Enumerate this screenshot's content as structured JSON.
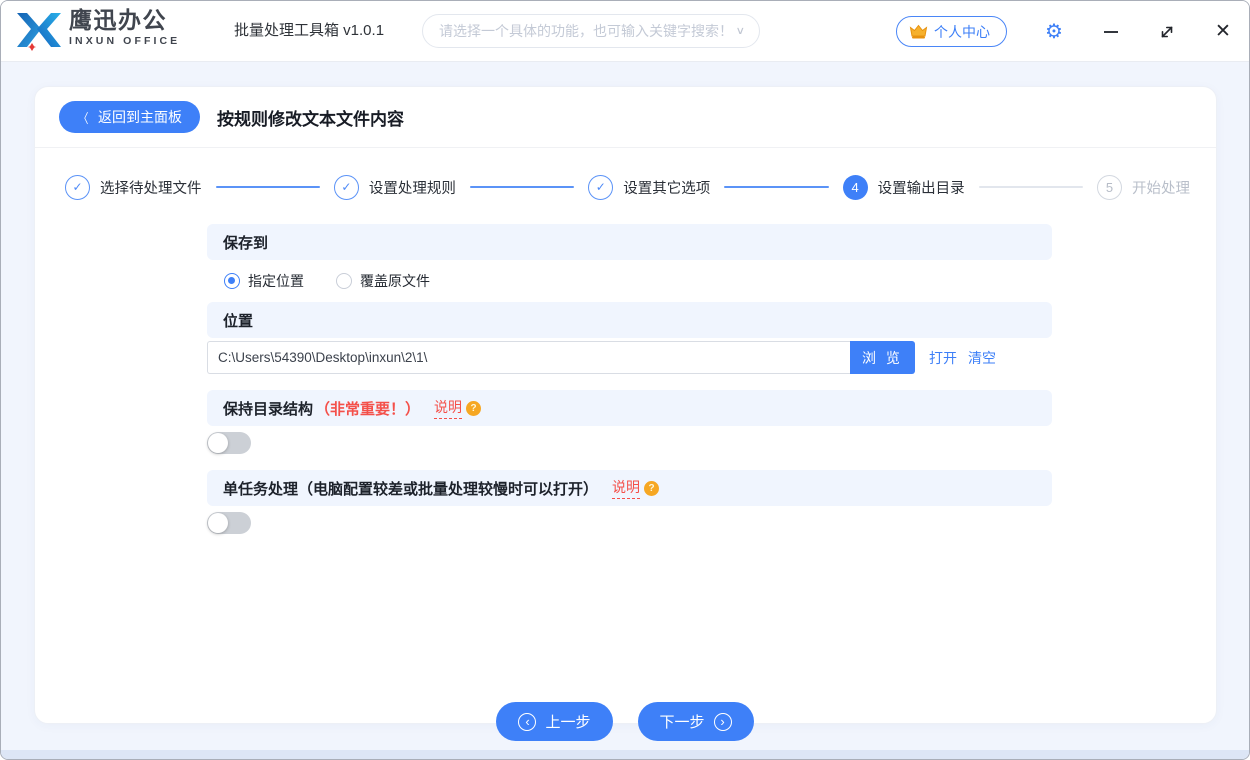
{
  "window": {
    "logo_title": "鹰迅办公",
    "logo_subtitle": "INXUN OFFICE",
    "app_title": "批量处理工具箱 v1.0.1",
    "search_placeholder": "请选择一个具体的功能，也可输入关键字搜索！",
    "user_center": "个人中心"
  },
  "panel": {
    "back_button": "返回到主面板",
    "title": "按规则修改文本文件内容"
  },
  "steps": [
    {
      "label": "选择待处理文件",
      "state": "done"
    },
    {
      "label": "设置处理规则",
      "state": "done"
    },
    {
      "label": "设置其它选项",
      "state": "done"
    },
    {
      "label": "设置输出目录",
      "state": "active",
      "number": "4"
    },
    {
      "label": "开始处理",
      "state": "pending",
      "number": "5"
    }
  ],
  "form": {
    "save_to": {
      "header": "保存到",
      "option_specified": "指定位置",
      "option_overwrite": "覆盖原文件",
      "selected": "指定位置"
    },
    "location": {
      "header": "位置",
      "path": "C:\\Users\\54390\\Desktop\\inxun\\2\\1\\",
      "browse": "浏 览",
      "open": "打开",
      "clear": "清空"
    },
    "keep_structure": {
      "header": "保持目录结构",
      "note": "（非常重要！）",
      "help": "说明",
      "enabled": false
    },
    "single_task": {
      "header": "单任务处理（电脑配置较差或批量处理较慢时可以打开）",
      "help": "说明",
      "enabled": false
    }
  },
  "footer": {
    "prev": "上一步",
    "next": "下一步"
  },
  "icons": {
    "back_chevron": "〈",
    "dropdown_chevron": "∨",
    "check": "✓",
    "help_qmark": "?",
    "gear": "⚙",
    "close": "✕",
    "prev_chevron": "‹",
    "next_chevron": "›"
  },
  "colors": {
    "primary": "#3e80f8",
    "section_bg": "#f0f5fe",
    "danger": "#f4504a",
    "warning": "#f6a723"
  }
}
